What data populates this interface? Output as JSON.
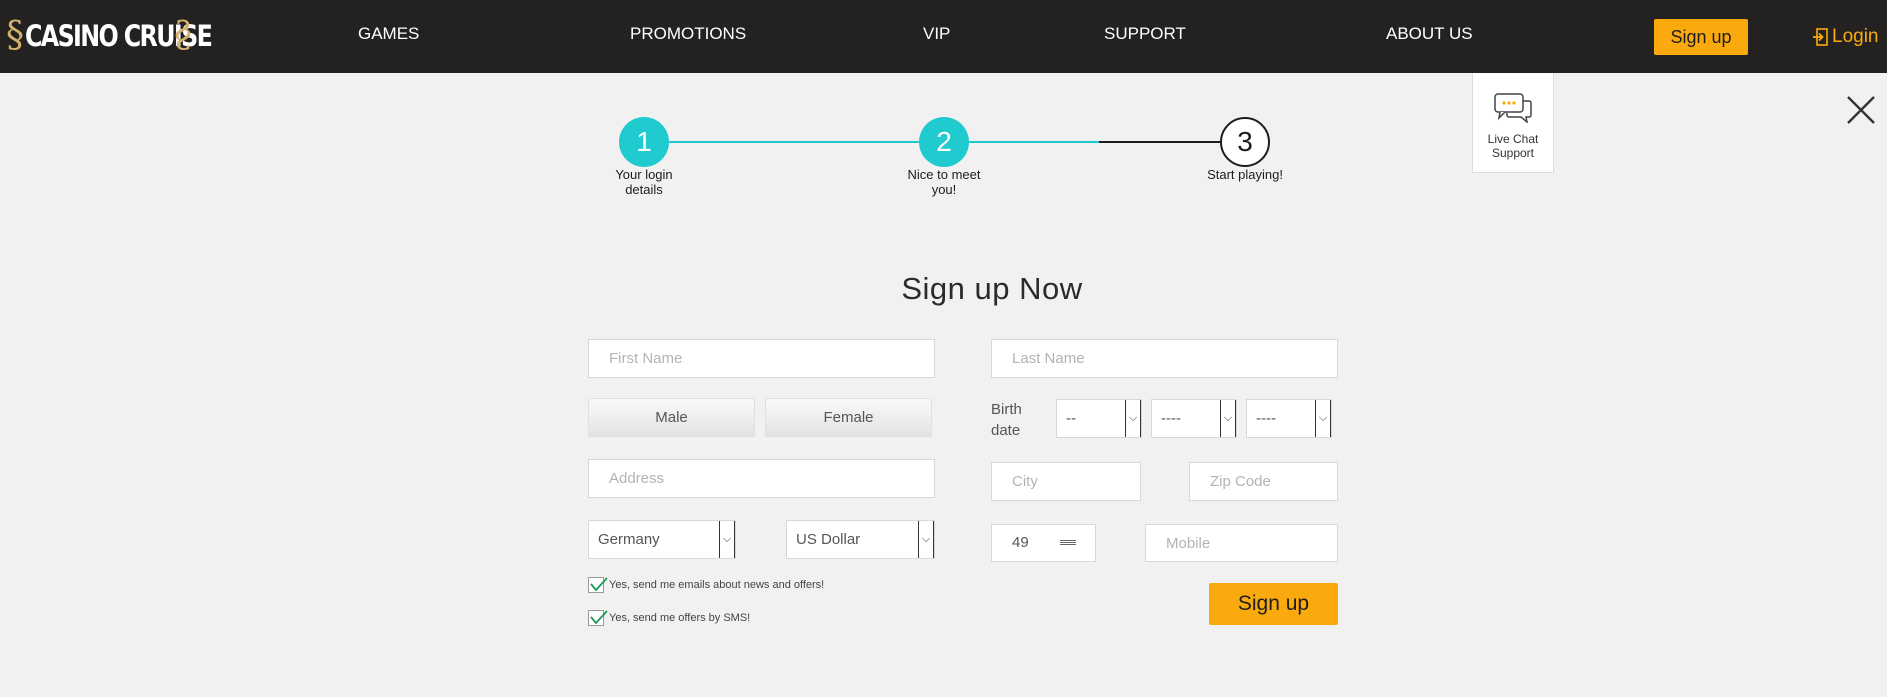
{
  "header": {
    "logo_text": "CASINO CRUISE",
    "nav": [
      "GAMES",
      "PROMOTIONS",
      "VIP",
      "SUPPORT",
      "ABOUT US"
    ],
    "signup_label": "Sign up",
    "login_label": "Login",
    "login_icon": "login-icon",
    "brand_color": "#fbaa0e"
  },
  "live_chat": {
    "label_line1": "Live Chat",
    "label_line2": "Support",
    "icon": "chat-bubble-icon"
  },
  "close_icon": "close-icon",
  "steps": [
    {
      "number": "1",
      "label_line1": "Your login",
      "label_line2": "details",
      "state": "done"
    },
    {
      "number": "2",
      "label_line1": "Nice to meet",
      "label_line2": "you!",
      "state": "done"
    },
    {
      "number": "3",
      "label_line1": "Start playing!",
      "label_line2": "",
      "state": "todo"
    }
  ],
  "step_accent_color": "#20cbcf",
  "form": {
    "title": "Sign up Now",
    "first_name_placeholder": "First Name",
    "last_name_placeholder": "Last Name",
    "male_label": "Male",
    "female_label": "Female",
    "birth_label_line1": "Birth",
    "birth_label_line2": "date",
    "birth_day": "--",
    "birth_month": "----",
    "birth_year": "----",
    "address_placeholder": "Address",
    "city_placeholder": "City",
    "zip_placeholder": "Zip Code",
    "country": "Germany",
    "currency": "US Dollar",
    "phone_prefix": "49",
    "mobile_placeholder": "Mobile",
    "email_offers_label": "Yes, send me emails about news and offers!",
    "sms_offers_label": "Yes, send me offers by SMS!",
    "email_offers_checked": true,
    "sms_offers_checked": true,
    "submit_label": "Sign up"
  }
}
